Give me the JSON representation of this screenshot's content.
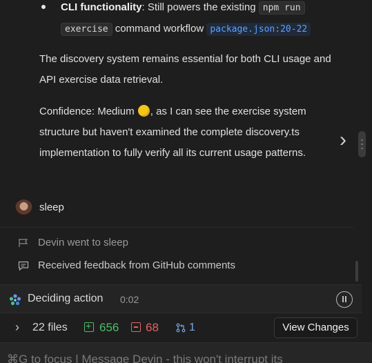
{
  "message": {
    "bullet": {
      "bold": "CLI functionality",
      "text1": ": Still powers the existing ",
      "code1": "npm run",
      "code2": "exercise",
      "text2": " command workflow ",
      "link": "package.json:20-22"
    },
    "paragraph1": "The discovery system remains essential for both CLI usage and API exercise data retrieval.",
    "paragraph2_before": "Confidence: Medium ",
    "paragraph2_after": ", as I can see the exercise system structure but haven't examined the complete discovery.ts implementation to fully verify all its current usage patterns.",
    "confidence_emoji": "yellow-circle"
  },
  "sleep": {
    "label": "sleep"
  },
  "events": [
    {
      "icon": "sleep-flag-icon",
      "text": "Devin went to sleep"
    },
    {
      "icon": "comment-icon",
      "text": "Received feedback from GitHub comments"
    }
  ],
  "status": {
    "text": "Deciding action",
    "time": "0:02"
  },
  "files": {
    "count_label": "22 files",
    "additions": "656",
    "deletions": "68",
    "pr_count": "1",
    "view_button": "View Changes"
  },
  "input": {
    "placeholder": "⌘G to focus | Message Devin - this won't interrupt its"
  },
  "colors": {
    "add": "#4fbf6a",
    "del": "#e06565",
    "link": "#5ea1ff",
    "bg": "#1e1e1e"
  }
}
